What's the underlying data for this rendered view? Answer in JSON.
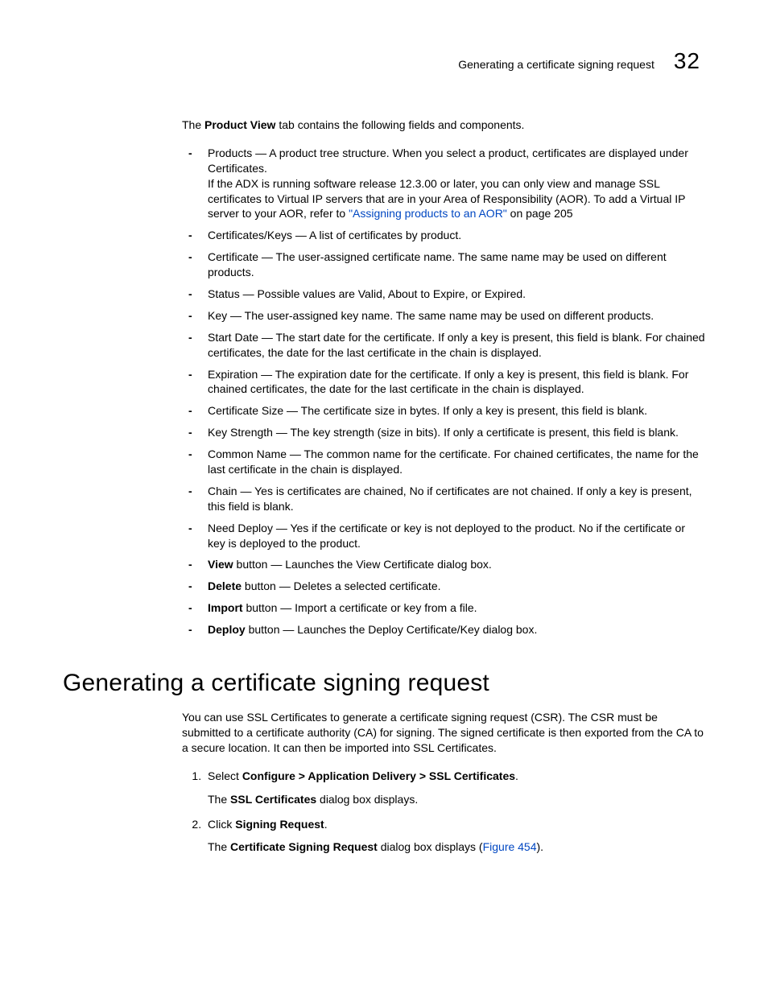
{
  "header": {
    "running_title": "Generating a certificate signing request",
    "chapter_number": "32"
  },
  "intro": {
    "prefix": "The ",
    "bold": "Product View",
    "suffix": " tab contains the following fields and components."
  },
  "bullets": [
    {
      "text": "Products — A product tree structure. When you select a product, certificates are displayed under Certificates.",
      "extra": "If the ADX is running software release 12.3.00 or later, you can only view and manage SSL certificates to Virtual IP servers that are in your Area of Responsibility (AOR). To add a Virtual IP server to your AOR, refer to ",
      "link_text": "\"Assigning products to an AOR\"",
      "after_link": " on page 205"
    },
    {
      "text": "Certificates/Keys — A list of certificates by product."
    },
    {
      "text": "Certificate — The user-assigned certificate name. The same name may be used on different products."
    },
    {
      "text": "Status — Possible values are Valid, About to Expire, or Expired."
    },
    {
      "text": "Key — The user-assigned key name. The same name may be used on different products."
    },
    {
      "text": "Start Date — The start date for the certificate. If only a key is present, this field is blank. For chained certificates, the date for the last certificate in the chain is displayed."
    },
    {
      "text": "Expiration — The expiration date for the certificate. If only a key is present, this field is blank. For chained certificates, the date for the last certificate in the chain is displayed."
    },
    {
      "text": "Certificate Size — The certificate size in bytes. If only a key is present, this field is blank."
    },
    {
      "text": "Key Strength — The key strength (size in bits). If only a certificate is present, this field is blank."
    },
    {
      "text": "Common Name — The common name for the certificate. For chained certificates, the name for the last certificate in the chain is displayed."
    },
    {
      "text": "Chain — Yes is certificates are chained, No if certificates are not chained. If only a key is present, this field is blank."
    },
    {
      "text": "Need Deploy — Yes if the certificate or key is not deployed to the product. No if the certificate or key is deployed to the product."
    },
    {
      "bold": "View",
      "text": " button — Launches the View Certificate dialog box."
    },
    {
      "bold": "Delete",
      "text": " button — Deletes a selected certificate."
    },
    {
      "bold": "Import",
      "text": " button — Import a certificate or key from a file."
    },
    {
      "bold": "Deploy",
      "text": " button — Launches the Deploy Certificate/Key dialog box."
    }
  ],
  "section": {
    "heading": "Generating a certificate signing request",
    "intro": "You can use SSL Certificates to generate a certificate signing request (CSR). The CSR must be submitted to a certificate authority (CA) for signing. The signed certificate is then exported from the CA to a secure location. It can then be imported into SSL Certificates.",
    "steps": [
      {
        "pre": "Select ",
        "bold": "Configure > Application Delivery > SSL Certificates",
        "post": ".",
        "follow_pre": "The ",
        "follow_bold": "SSL Certificates",
        "follow_post": " dialog box displays."
      },
      {
        "pre": "Click ",
        "bold": "Signing Request",
        "post": ".",
        "follow_pre": "The ",
        "follow_bold": "Certificate Signing Request",
        "follow_post": " dialog box displays (",
        "follow_link": "Figure 454",
        "follow_after_link": ")."
      }
    ]
  }
}
